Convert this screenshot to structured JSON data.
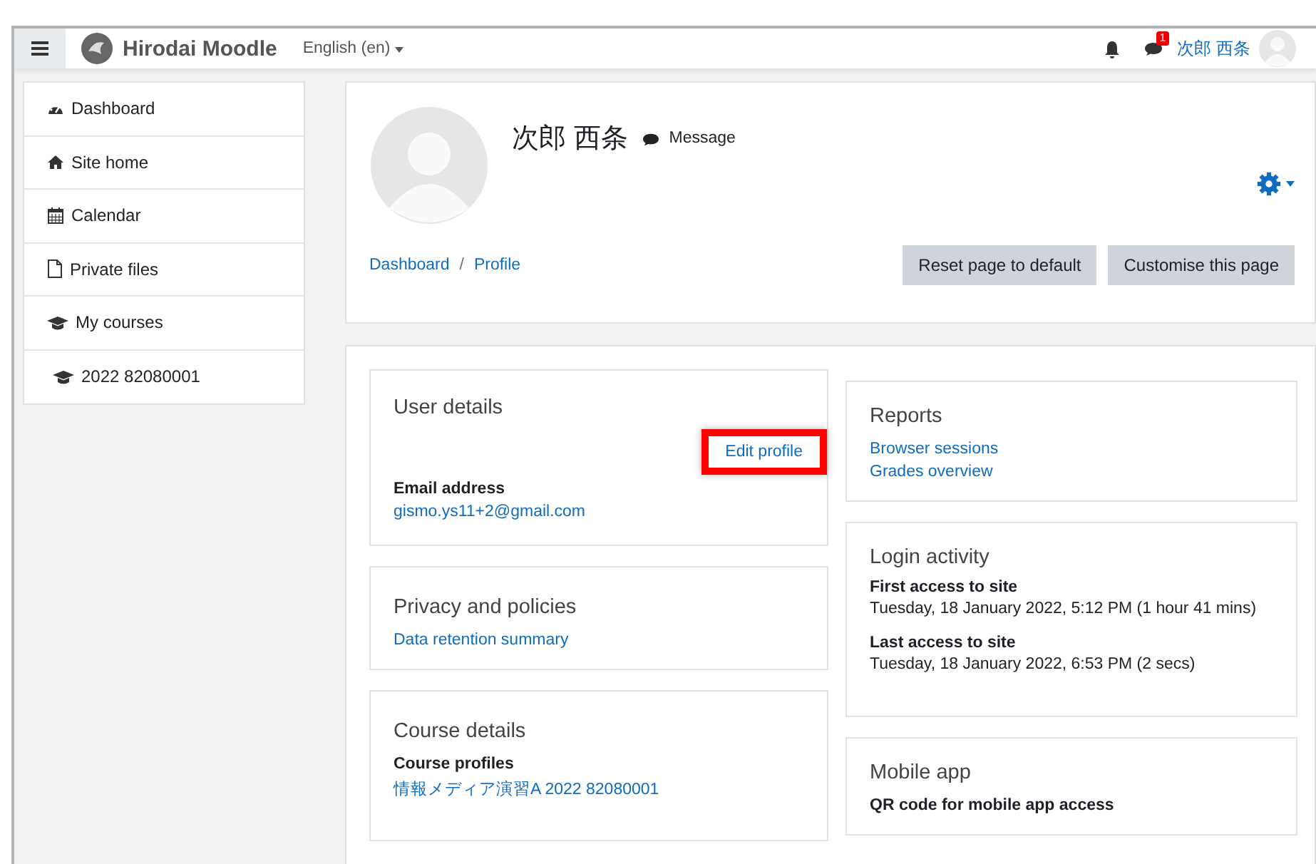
{
  "navbar": {
    "site_name": "Hirodai Moodle",
    "language": "English (en)",
    "notification_count": "1",
    "user_name": "次郎 西条"
  },
  "sidebar": {
    "items": [
      {
        "label": "Dashboard",
        "kind": "dashboard"
      },
      {
        "label": "Site home",
        "kind": "home"
      },
      {
        "label": "Calendar",
        "kind": "calendar"
      },
      {
        "label": "Private files",
        "kind": "file"
      },
      {
        "label": "My courses",
        "kind": "course",
        "children": [
          {
            "label": "2022 82080001",
            "kind": "course"
          }
        ]
      }
    ]
  },
  "header": {
    "user_name": "次郎 西条",
    "message_link": "Message",
    "breadcrumb": [
      "Dashboard",
      "Profile"
    ],
    "breadcrumb_separator": "/",
    "buttons": [
      "Reset page to default",
      "Customise this page"
    ]
  },
  "user_details": {
    "title": "User details",
    "edit_link": {
      "label": "Edit profile",
      "highlighted": true
    },
    "field_label": "Email address",
    "field_value": "gismo.ys11+2@gmail.com"
  },
  "privacy": {
    "title": "Privacy and policies",
    "links": [
      "Data retention summary"
    ]
  },
  "course_details": {
    "title": "Course details",
    "field_label": "Course profiles",
    "links": [
      "情報メディア演習A 2022 82080001"
    ]
  },
  "reports": {
    "title": "Reports",
    "links": [
      "Browser sessions",
      "Grades overview"
    ]
  },
  "login_activity": {
    "title": "Login activity",
    "entries": [
      {
        "label": "First access to site",
        "value": "Tuesday, 18 January 2022, 5:12 PM  (1 hour 41 mins)"
      },
      {
        "label": "Last access to site",
        "value": "Tuesday, 18 January 2022, 6:53 PM  (2 secs)"
      }
    ]
  },
  "mobile_app": {
    "title": "Mobile app",
    "field_label": "QR code for mobile app access"
  }
}
